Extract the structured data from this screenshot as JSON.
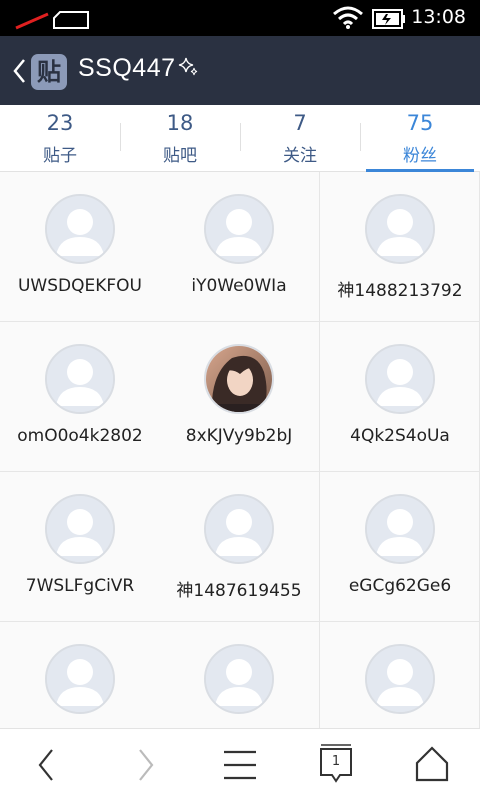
{
  "status_bar": {
    "time": "13:08"
  },
  "header": {
    "logo_text": "贴",
    "title": "SSQ447"
  },
  "tabs": [
    {
      "count": "23",
      "label": "贴子"
    },
    {
      "count": "18",
      "label": "贴吧"
    },
    {
      "count": "7",
      "label": "关注"
    },
    {
      "count": "75",
      "label": "粉丝"
    }
  ],
  "followers": [
    {
      "name": "UWSDQEKFOU",
      "avatar": "default"
    },
    {
      "name": "iY0We0WIa",
      "avatar": "default"
    },
    {
      "name": "神1488213792",
      "avatar": "default"
    },
    {
      "name": "omO0o4k2802",
      "avatar": "default"
    },
    {
      "name": "8xKJVy9b2bJ",
      "avatar": "photo"
    },
    {
      "name": "4Qk2S4oUa",
      "avatar": "default"
    },
    {
      "name": "7WSLFgCiVR",
      "avatar": "default"
    },
    {
      "name": "神1487619455",
      "avatar": "default"
    },
    {
      "name": "eGCg62Ge6",
      "avatar": "default"
    },
    {
      "name": "",
      "avatar": "default"
    },
    {
      "name": "",
      "avatar": "default"
    },
    {
      "name": "",
      "avatar": "default"
    }
  ],
  "bottom_nav": {
    "tab_count": "1"
  },
  "colors": {
    "header_bg": "#2a3141",
    "accent": "#3b86d8",
    "tab_text": "#3e5a86"
  }
}
